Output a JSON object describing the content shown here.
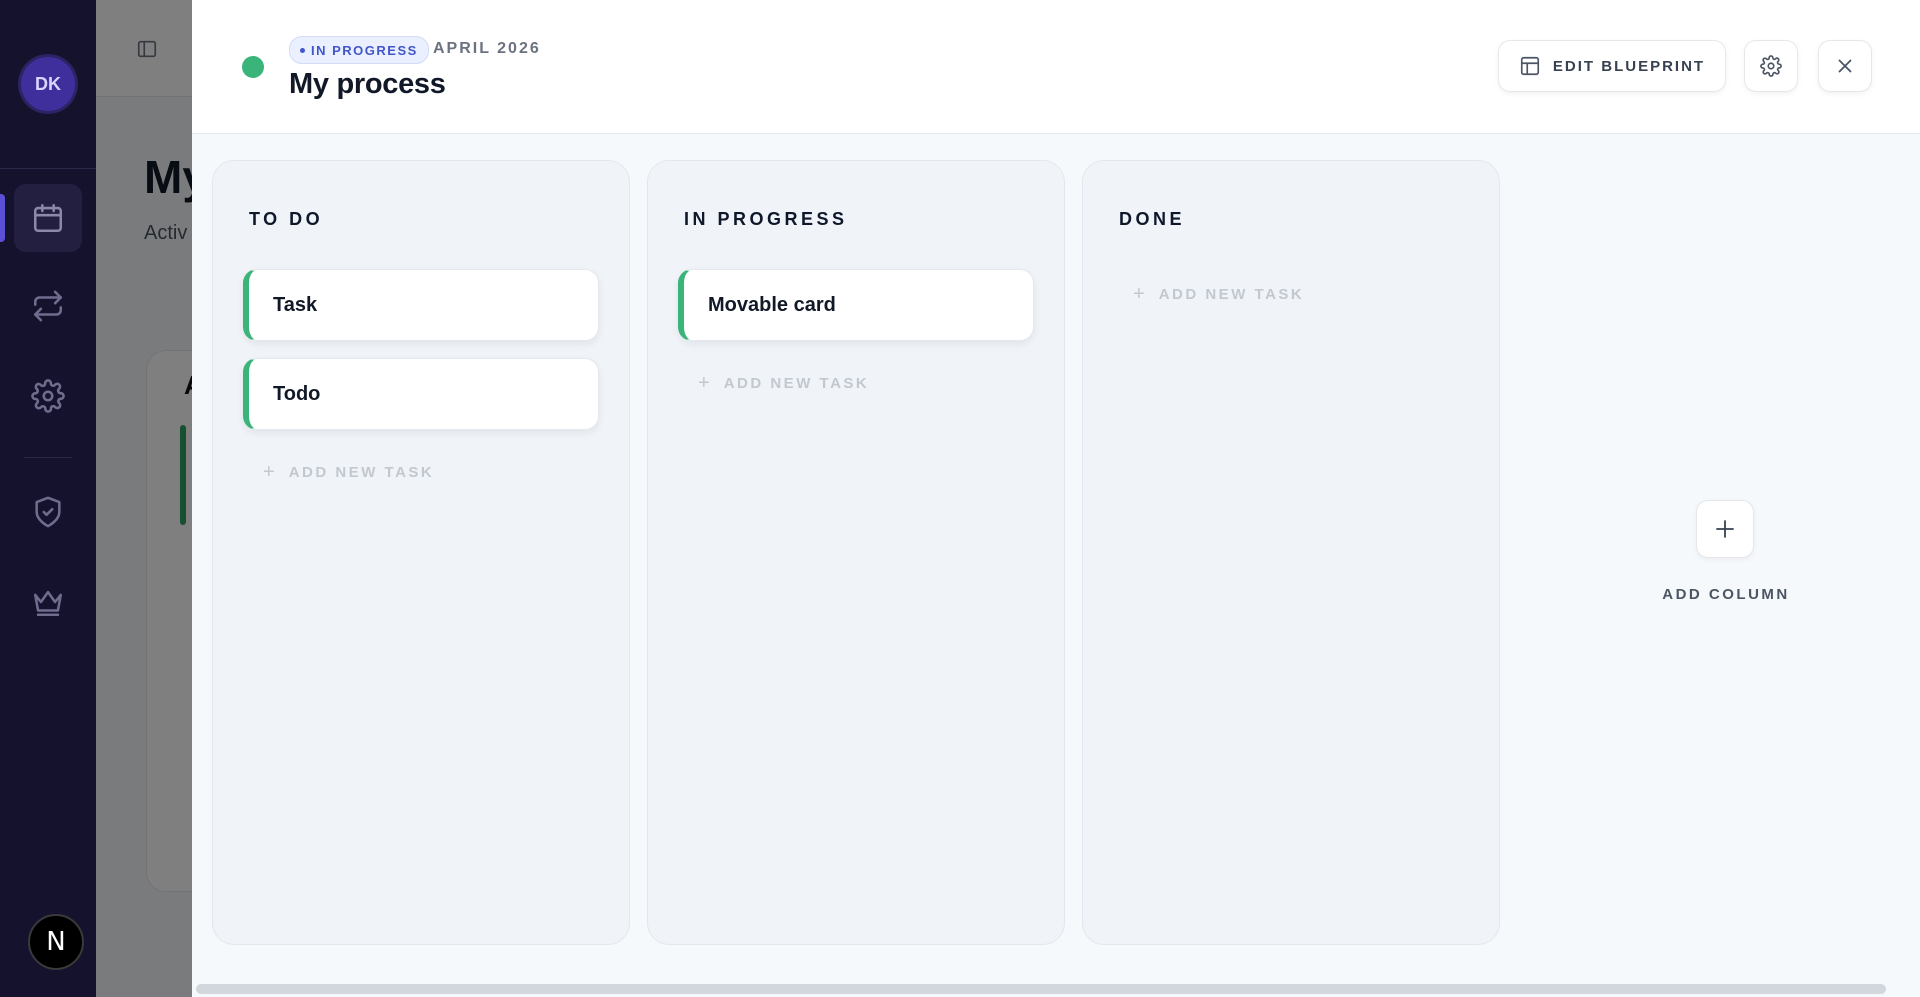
{
  "sidebar": {
    "avatar_initials": "DK",
    "items": [
      {
        "icon": "calendar-icon",
        "active": true
      },
      {
        "icon": "repeat-icon",
        "active": false
      },
      {
        "icon": "gear-icon",
        "active": false
      },
      {
        "icon": "shield-check-icon",
        "active": false
      },
      {
        "icon": "crown-icon",
        "active": false
      }
    ],
    "logo_letter": "N"
  },
  "background_page": {
    "title": "My",
    "subtitle": "Activ",
    "card_letter": "A"
  },
  "drawer": {
    "status_badge": "IN PROGRESS",
    "date": "APRIL 2026",
    "title": "My process",
    "edit_blueprint_label": "EDIT BLUEPRINT",
    "status_color": "#3bb47a"
  },
  "board": {
    "columns": [
      {
        "title": "TO DO",
        "tasks": [
          "Task",
          "Todo"
        ],
        "add_label": "ADD NEW TASK"
      },
      {
        "title": "IN PROGRESS",
        "tasks": [
          "Movable card"
        ],
        "add_label": "ADD NEW TASK"
      },
      {
        "title": "DONE",
        "tasks": [],
        "add_label": "ADD NEW TASK"
      }
    ],
    "add_column_label": "ADD COLUMN",
    "add_symbol": "+"
  },
  "colors": {
    "sidebar_bg": "#15122e",
    "accent": "#5b4fd6",
    "task_accent": "#3bb47a",
    "badge_text": "#4256c9"
  }
}
